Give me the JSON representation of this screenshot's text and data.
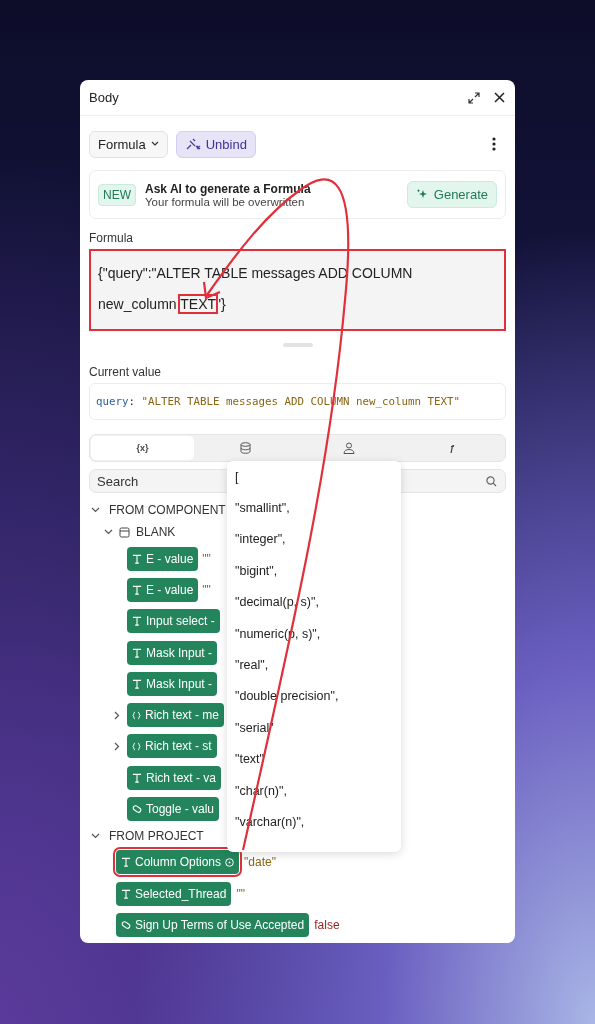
{
  "panel": {
    "title": "Body"
  },
  "toolbar": {
    "mode_button": "Formula",
    "unbind_button": "Unbind"
  },
  "ai_banner": {
    "badge": "NEW",
    "title": "Ask AI to generate a Formula",
    "subtitle": "Your formula will be overwritten",
    "button": "Generate"
  },
  "formula": {
    "label": "Formula",
    "highlighted": true,
    "before": "{\"query\":\"ALTER TABLE messages ADD COLUMN new_column ",
    "marked": "TEXT",
    "after": "\"}"
  },
  "current_value": {
    "label": "Current value",
    "key": "query",
    "separator": ":",
    "value": "\"ALTER TABLE messages ADD COLUMN new_column TEXT\""
  },
  "tabs": [
    {
      "kind": "text",
      "label": "{x}",
      "selected": true
    },
    {
      "kind": "database",
      "selected": false
    },
    {
      "kind": "user",
      "selected": false
    },
    {
      "kind": "text",
      "label": "ƒ",
      "selected": false
    }
  ],
  "search": {
    "placeholder": "Search"
  },
  "tree": [
    {
      "label": "FROM COMPONENT",
      "expanded": true,
      "children": [
        {
          "label": "BLANK",
          "expanded": true,
          "children": [
            {
              "kind": "text",
              "label": "E - value",
              "value": "\"\""
            },
            {
              "kind": "text",
              "label": "E - value",
              "value": "\"\""
            },
            {
              "kind": "text",
              "label": "Input select -"
            },
            {
              "kind": "text",
              "label": "Mask Input -"
            },
            {
              "kind": "text",
              "label": "Mask Input -"
            },
            {
              "kind": "object",
              "label": "Rich text - me",
              "expanded": false
            },
            {
              "kind": "object",
              "label": "Rich text - st",
              "expanded": false
            },
            {
              "kind": "text",
              "label": "Rich text - va"
            },
            {
              "kind": "boolean",
              "label": "Toggle - valu"
            }
          ]
        }
      ]
    },
    {
      "label": "FROM PROJECT",
      "expanded": true,
      "items": [
        {
          "kind": "text",
          "label": "Column Options",
          "info": true,
          "highlighted": true,
          "value": "\"date\""
        },
        {
          "kind": "text",
          "label": "Selected_Thread",
          "value": "\"\""
        },
        {
          "kind": "boolean",
          "label": "Sign Up Terms of Use Accepted",
          "value": "false"
        }
      ]
    }
  ],
  "popup": {
    "items": [
      "[",
      "\"smallint\",",
      "\"integer\",",
      "\"bigint\",",
      "\"decimal(p, s)\",",
      "\"numeric(p, s)\",",
      "\"real\",",
      "\"double precision\",",
      "\"serial\"",
      "\"text\"",
      "\"char(n)\",",
      "\"varchar(n)\","
    ]
  }
}
